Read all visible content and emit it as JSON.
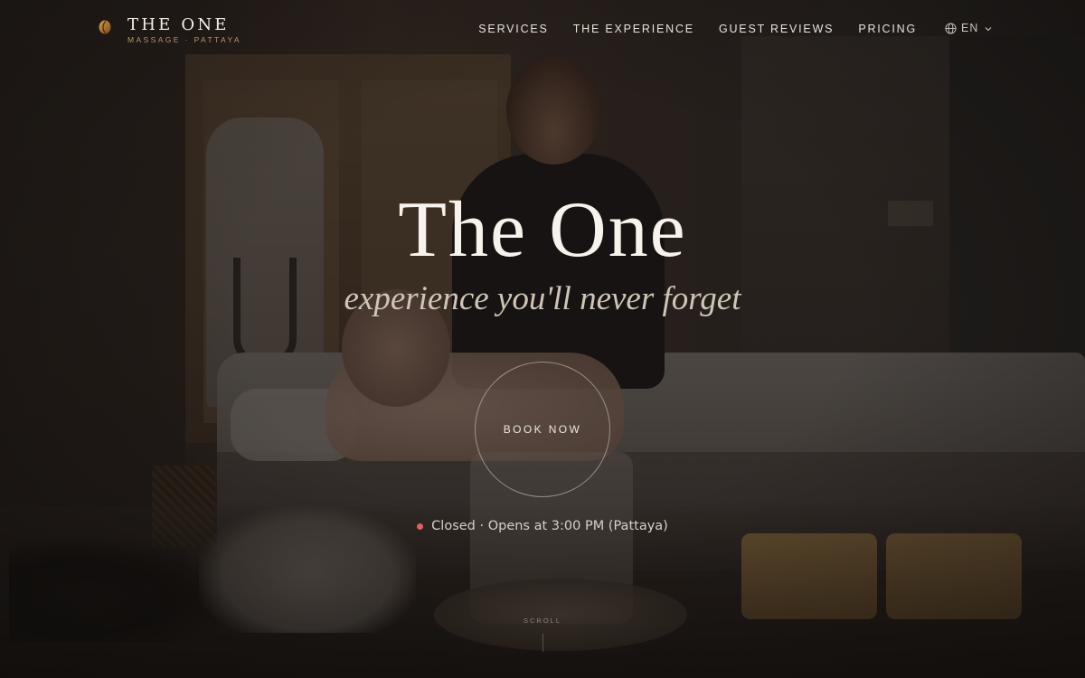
{
  "brand": {
    "name": "THE ONE",
    "subtitle": "MASSAGE · PATTAYA",
    "mark_color": "#b7832f"
  },
  "nav": {
    "items": [
      {
        "label": "SERVICES"
      },
      {
        "label": "THE EXPERIENCE"
      },
      {
        "label": "GUEST REVIEWS"
      },
      {
        "label": "PRICING"
      }
    ],
    "language": {
      "label": "EN",
      "icon": "globe-icon",
      "chevron": "chevron-down-icon"
    }
  },
  "hero": {
    "title": "The One",
    "tagline": "experience you'll never forget",
    "cta_label": "BOOK NOW",
    "status": {
      "text": "Closed · Opens at 3:00 PM (Pattaya)",
      "state_color": "#e0615a"
    },
    "scroll_label": "SCROLL"
  }
}
